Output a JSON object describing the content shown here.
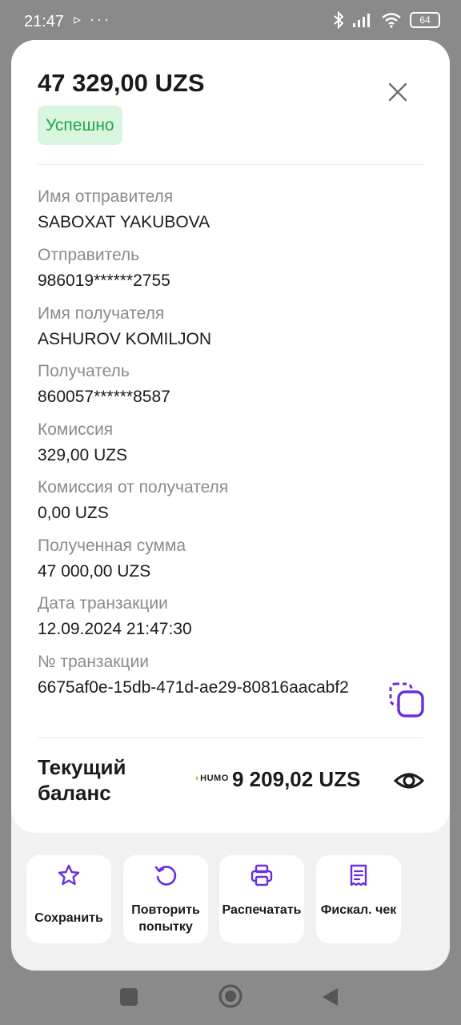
{
  "status_bar": {
    "time": "21:47",
    "extra": "▹ ···",
    "battery": "64"
  },
  "transaction": {
    "amount": "47 329,00 UZS",
    "status": "Успешно",
    "status_color": "#1ea84a",
    "fields": [
      {
        "label": "Имя отправителя",
        "value": "SABOXAT YAKUBOVA"
      },
      {
        "label": "Отправитель",
        "value": "986019******2755"
      },
      {
        "label": "Имя получателя",
        "value": "ASHUROV KOMILJON"
      },
      {
        "label": "Получатель",
        "value": "860057******8587"
      },
      {
        "label": "Комиссия",
        "value": "329,00 UZS"
      },
      {
        "label": "Комиссия от получателя",
        "value": "0,00 UZS"
      },
      {
        "label": "Полученная сумма",
        "value": "47 000,00 UZS"
      },
      {
        "label": "Дата транзакции",
        "value": "12.09.2024 21:47:30"
      },
      {
        "label": "№ транзакции",
        "value": "6675af0e-15db-471d-ae29-80816aacabf2"
      }
    ]
  },
  "balance": {
    "label": "Текущий баланс",
    "card_brand": "HUMO",
    "value": "9 209,02 UZS"
  },
  "actions": [
    {
      "label": "Сохранить",
      "icon": "star-icon"
    },
    {
      "label": "Повторить попытку",
      "icon": "refresh-icon"
    },
    {
      "label": "Распечатать",
      "icon": "printer-icon"
    },
    {
      "label": "Фискал. чек",
      "icon": "receipt-icon"
    }
  ],
  "accent_color": "#6a2ee0"
}
